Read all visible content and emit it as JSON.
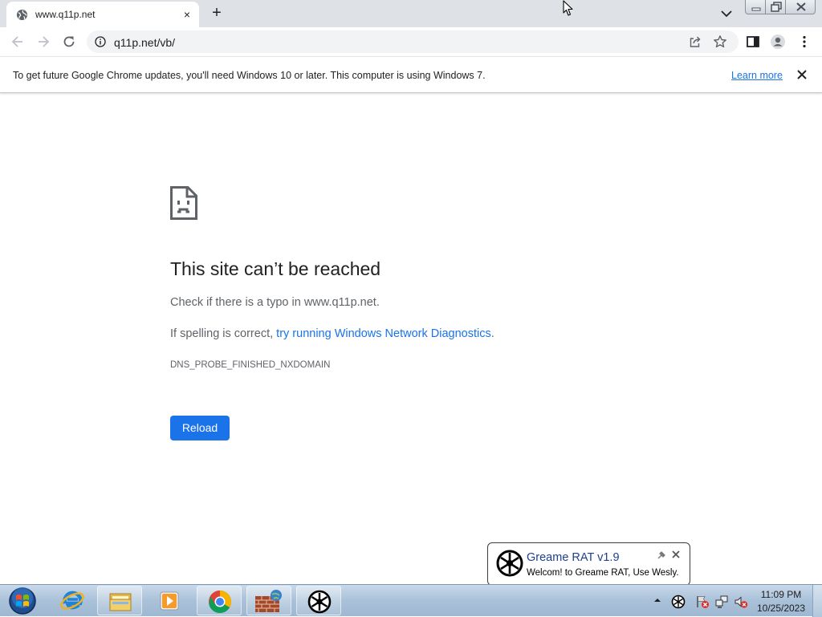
{
  "browser": {
    "tab": {
      "title": "www.q11p.net",
      "close": "×"
    },
    "new_tab": "+",
    "address": "q11p.net/vb/"
  },
  "infobar": {
    "message": "To get future Google Chrome updates, you'll need Windows 10 or later. This computer is using Windows 7.",
    "learn_more": "Learn more"
  },
  "error_page": {
    "title": "This site can’t be reached",
    "line1": "Check if there is a typo in www.q11p.net.",
    "line2_prefix": "If spelling is correct, ",
    "line2_link": "try running Windows Network Diagnostics",
    "line2_suffix": ".",
    "error_code": "DNS_PROBE_FINISHED_NXDOMAIN",
    "reload": "Reload"
  },
  "balloon": {
    "title": "Greame RAT v1.9",
    "message": "Welcom! to Greame RAT, Use Wesly."
  },
  "taskbar": {
    "apps": [
      "start-orb",
      "internet-explorer",
      "windows-explorer",
      "media-player",
      "chrome",
      "firewall-app",
      "greame-rat"
    ],
    "clock_time": "11:09 PM",
    "clock_date": "10/25/2023"
  },
  "colors": {
    "accent": "#1a73e8",
    "tabstrip": "#dee1e6",
    "text": "#202124",
    "secondary_text": "#5f6368"
  }
}
